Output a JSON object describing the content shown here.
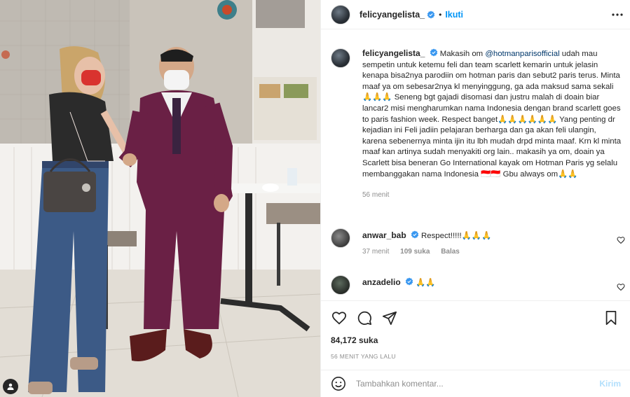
{
  "colors": {
    "accent": "#0095f6",
    "verified": "#3897f0",
    "muted": "#8e8e8e",
    "text": "#262626",
    "post_disabled": "#b2dffc"
  },
  "header": {
    "username": "felicyangelista_",
    "separator": "•",
    "follow_label": "Ikuti",
    "more_icon": "more-horizontal-icon"
  },
  "caption": {
    "username": "felicyangelista_",
    "text_before_mention": "Makasih om ",
    "mention": "@hotmanparisofficial",
    "text_after_mention": " udah mau sempetin untuk ketemu feli dan team scarlett kemarin untuk jelasin kenapa bisa2nya parodiin om hotman paris dan sebut2 paris terus. Minta maaf ya om sebesar2nya kl menyinggung, ga ada maksud sama sekali🙏🙏🙏 Seneng bgt gajadi disomasi dan justru malah di doain biar lancar2 misi mengharumkan nama Indonesia dengan brand scarlett goes to paris fashion week. Respect banget🙏🙏🙏🙏🙏🙏 Yang penting dr kejadian ini Feli jadiin pelajaran berharga dan ga akan feli ulangin, karena sebenernya minta ijin itu lbh mudah drpd minta maaf. Krn kl minta maaf kan artinya sudah menyakiti org lain.. makasih ya om, doain ya Scarlett bisa beneran Go International kayak om Hotman Paris yg selalu membanggakan nama Indonesia 🇮🇩🇮🇩 Gbu always om🙏🙏",
    "time": "56 menit"
  },
  "comments": [
    {
      "username": "anwar_bab",
      "text": "Respect!!!!!🙏🙏🙏",
      "time": "37 menit",
      "likes": "109 suka",
      "reply_label": "Balas"
    },
    {
      "username": "anzadelio",
      "text": "🙏🙏",
      "time": "",
      "likes": "",
      "reply_label": ""
    }
  ],
  "actions": {
    "like_icon": "heart-icon",
    "comment_icon": "comment-icon",
    "share_icon": "share-icon",
    "save_icon": "bookmark-icon",
    "likes_count": "84,172 suka",
    "timestamp": "56 MENIT YANG LALU"
  },
  "add_comment": {
    "placeholder": "Tambahkan komentar...",
    "post_label": "Kirim",
    "emoji_icon": "emoji-icon"
  }
}
